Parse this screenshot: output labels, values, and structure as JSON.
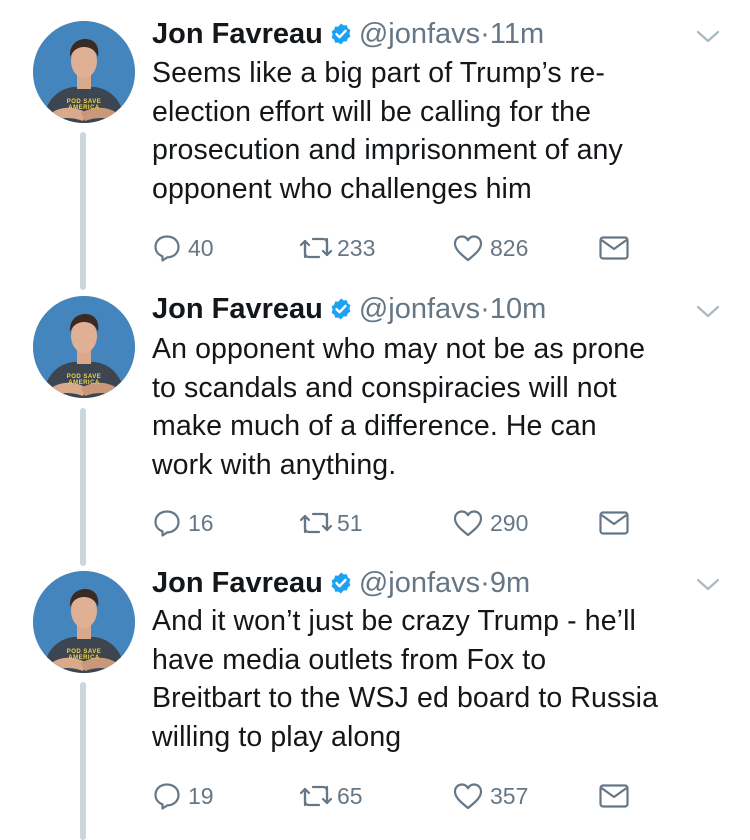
{
  "colors": {
    "text": "#14171a",
    "secondary": "#657786",
    "verified": "#1da1f2",
    "thread_line": "#ccd6dd",
    "avatar_bg": "#3f7fb7",
    "shirt": "#3d4650"
  },
  "tweets": [
    {
      "name": "Jon Favreau",
      "handle": "@jonfavs",
      "dot": "·",
      "time": "11m",
      "text": "Seems like a big part of Trump’s re-election effort will be calling for the prosecution and imprisonment of any opponent who challenges him",
      "lines": [
        "Seems like a big part of Trump’s re-",
        "election effort will be calling for the",
        "prosecution and imprisonment of any",
        "opponent who challenges him"
      ],
      "replies": "40",
      "retweets": "233",
      "likes": "826",
      "shirt_text": [
        "POD SAVE",
        "AMERICA"
      ]
    },
    {
      "name": "Jon Favreau",
      "handle": "@jonfavs",
      "dot": "·",
      "time": "10m",
      "text": "An opponent who may not be as prone to scandals and conspiracies will not make much of a difference. He can work with anything.",
      "lines": [
        "An opponent who may not be as prone",
        "to scandals and conspiracies will not",
        "make much of a difference. He can",
        "work with anything."
      ],
      "replies": "16",
      "retweets": "51",
      "likes": "290",
      "shirt_text": [
        "POD SAVE",
        "AMERICA"
      ]
    },
    {
      "name": "Jon Favreau",
      "handle": "@jonfavs",
      "dot": "·",
      "time": "9m",
      "text": "And it won’t just be crazy Trump - he’ll have media outlets from Fox to Breitbart to the WSJ ed board to Russia willing to play along",
      "lines": [
        "And it won’t just be crazy Trump - he’ll",
        "have media outlets from Fox to",
        "Breitbart to the WSJ ed board to Russia",
        "willing to play along"
      ],
      "replies": "19",
      "retweets": "65",
      "likes": "357",
      "shirt_text": [
        "POD SAVE",
        "AMERICA"
      ]
    }
  ],
  "icons": {
    "reply": "reply-icon",
    "retweet": "retweet-icon",
    "like": "heart-icon",
    "dm": "envelope-icon",
    "verified": "verified-badge-icon",
    "caret": "chevron-down-icon"
  }
}
